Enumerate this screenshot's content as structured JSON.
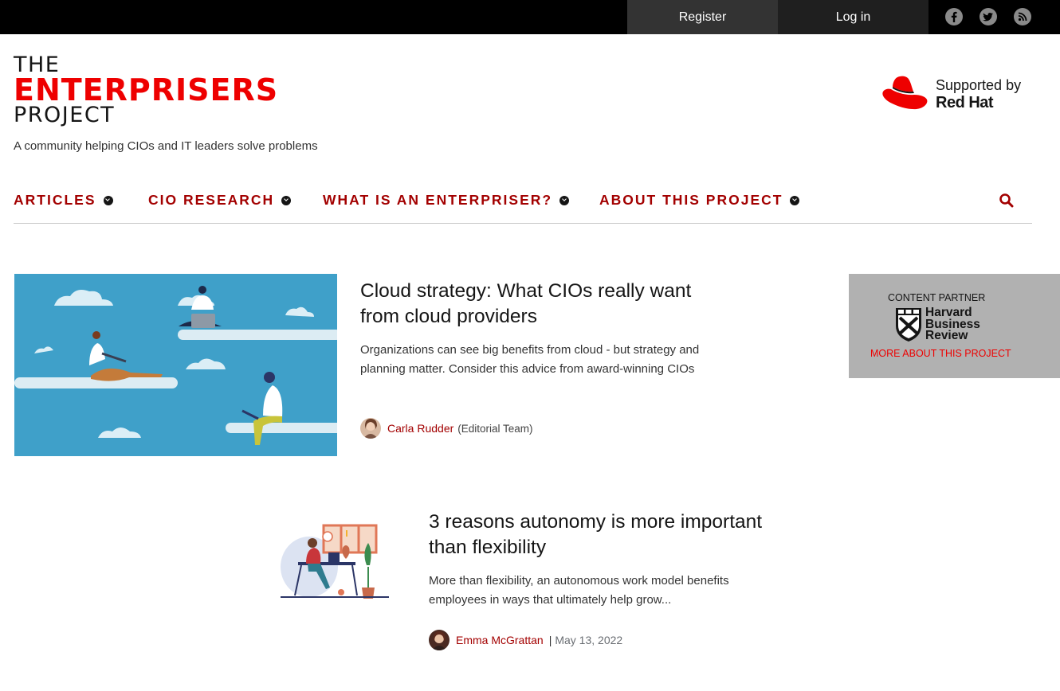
{
  "topbar": {
    "register": "Register",
    "login": "Log in",
    "social": [
      "facebook-icon",
      "twitter-icon",
      "rss-icon"
    ]
  },
  "logo": {
    "line1": "THE",
    "line2": "ENTERPRISERS",
    "line3": "PROJECT"
  },
  "tagline": "A community helping CIOs and IT leaders solve problems",
  "sponsor": {
    "supported_by": "Supported by",
    "name": "Red Hat"
  },
  "nav": {
    "items": [
      {
        "label": "ARTICLES"
      },
      {
        "label": "CIO RESEARCH"
      },
      {
        "label": "WHAT IS AN ENTERPRISER?"
      },
      {
        "label": "ABOUT THIS PROJECT"
      }
    ]
  },
  "articles": [
    {
      "title": "Cloud strategy: What CIOs really want from cloud providers",
      "description": "Organizations can see big benefits from cloud - but strategy and planning matter. Consider this advice from award-winning CIOs",
      "author": "Carla Rudder",
      "role": "(Editorial Team)"
    },
    {
      "title": "3 reasons autonomy is more important than flexibility",
      "description": "More than flexibility, an autonomous work model benefits employees in ways that ultimately help grow...",
      "author": "Emma McGrattan",
      "separator": "|",
      "date": "May 13, 2022"
    }
  ],
  "partner": {
    "label": "CONTENT PARTNER",
    "hbr_line1": "Harvard",
    "hbr_line2": "Business",
    "hbr_line3": "Review",
    "link": "MORE ABOUT THIS PROJECT"
  },
  "colors": {
    "brand_red": "#ee0000",
    "nav_red": "#a30000",
    "topbar": "#000000"
  }
}
